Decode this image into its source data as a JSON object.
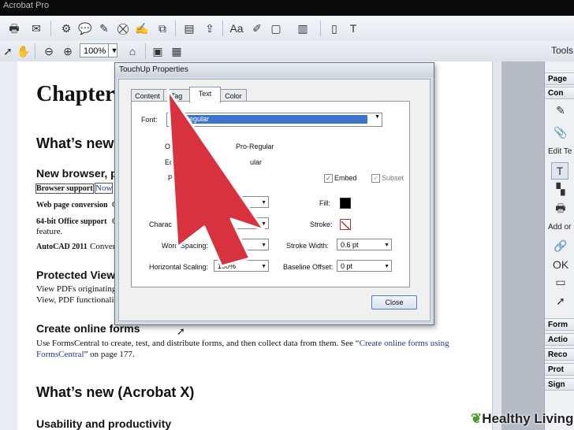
{
  "app": {
    "title": "Acrobat Pro"
  },
  "toolbar": {
    "zoom_value": "100%",
    "tools_label": "Tools"
  },
  "document": {
    "chapter_heading": "Chapter",
    "h_whats_new": "What’s new",
    "h_new_browser": "New browser, p",
    "browser_support": "Browser support",
    "now": "Now",
    "web_page_conversion": "Web page conversion",
    "web_page_conversion_tail": "C",
    "office_support": "64-bit Office support",
    "office_support_tail": "C",
    "feature": "feature.",
    "autocad": "AutoCAD 2011",
    "autocad_tail": "Conver",
    "h_protected_view": "Protected View",
    "protected_line1": "View PDFs originating",
    "protected_line2": "View, PDF functionalit",
    "h_create_online_forms": "Create online forms",
    "forms_line1_a": "Use FormsCentral to create, test, and distribute forms, and then collect data from them. See “",
    "forms_line1_link": "Create online forms using",
    "forms_line2_link": "FormsCentral",
    "forms_line2_b": "” on page 177.",
    "h_acrobat_x": "What’s new (Acrobat X)",
    "h_usability": "Usability and productivity"
  },
  "right_panel": {
    "page": "Page",
    "content": "Con",
    "edit_text": "Edit Te",
    "add_or": "Add or",
    "forms": "Form",
    "action": "Actio",
    "recognize": "Reco",
    "protect": "Prot",
    "sign": "Sign"
  },
  "dialog": {
    "title": "TouchUp Properties",
    "tabs": [
      "Content",
      "Tag",
      "Text",
      "Color"
    ],
    "active_tab": "Text",
    "font_label": "Font:",
    "font_value": "M... Regular",
    "original_label": "Ori",
    "original_value": "Pro-Regular",
    "edit_label": "Ec",
    "edit_value": "ular",
    "p_label": "P",
    "embed_label": "Embed",
    "subset_label": "Subset",
    "fill_label": "Fill:",
    "char_spacing_label": "Charac",
    "char_spacing_tail": "pacing:",
    "char_spacing_value": "0",
    "stroke_label": "Stroke:",
    "word_spacing_label": "Word Spacing:",
    "word_spacing_value": "0",
    "stroke_width_label": "Stroke Width:",
    "stroke_width_value": "0.6 pt",
    "horizontal_scaling_label": "Horizontal Scaling:",
    "horizontal_scaling_value": "100%",
    "baseline_offset_label": "Baseline Offset:",
    "baseline_offset_value": "0 pt",
    "close_label": "Close"
  },
  "watermark": {
    "text": "Healthy Living"
  },
  "colors": {
    "arrow": "#d8323f",
    "selection": "#3b74c9",
    "link": "#1d3a8f"
  }
}
